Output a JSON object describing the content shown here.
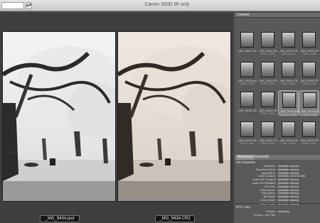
{
  "window_title": "Canon 350D IR only",
  "toolbar": {
    "stepper_icon": "▴▾"
  },
  "preview": {
    "captions": [
      "_MG_9434.psd",
      "_MG_9434.CR2"
    ]
  },
  "content_panel": {
    "tab_label": "Content",
    "items": [
      {
        "name": "_MG_9447.CR2",
        "info": "",
        "selected": false
      },
      {
        "name": "_MG_9441.CR2",
        "info": "2304 x 3456",
        "selected": false
      },
      {
        "name": "_MG_9437.CR2",
        "info": "2304 x 3456",
        "selected": false
      },
      {
        "name": "_MG_9440.CR2",
        "info": "2304 x 3456",
        "selected": false
      },
      {
        "name": "_MG_9442.psd",
        "info": "3456 x 2304",
        "selected": false
      },
      {
        "name": "_MG_9442.CR2",
        "info": "3456 x 2304",
        "selected": false
      },
      {
        "name": "_MG_9441.CR2",
        "info": "2304 x 3456",
        "selected": false
      },
      {
        "name": "_MG_9435.CR2",
        "info": "2304 x 3456",
        "selected": false
      },
      {
        "name": "_MG_9433.CR2",
        "info": "",
        "selected": false
      },
      {
        "name": "_MG_9432.CR2",
        "info": "2304 x 3456",
        "selected": false
      },
      {
        "name": "_MG_9434.psd",
        "info": "2304 x 3456",
        "selected": true
      },
      {
        "name": "_MG_9434.CR2",
        "info": "2304 x 3456",
        "selected": true
      },
      {
        "name": "_MG_9429.CR2",
        "info": "2304 x 3456",
        "selected": false
      },
      {
        "name": "_MG_9427.CR2",
        "info": "2304 x 3456",
        "selected": false
      },
      {
        "name": "_MG_9422.CR2",
        "info": "2304 x 3456",
        "selected": false
      },
      {
        "name": "_MG_9423.CR2",
        "info": "3456 x 2304",
        "selected": false
      }
    ]
  },
  "metadata_panel": {
    "tabs": [
      "Metadata",
      "Keywords"
    ],
    "file_properties_title": "File Properties",
    "fields": [
      {
        "key": "Filename",
        "value": "(Multiple values)"
      },
      {
        "key": "Document Kind",
        "value": "(Multiple values)"
      },
      {
        "key": "Application",
        "value": "(Multiple values)"
      },
      {
        "key": "Date Created",
        "value": "16/01/06, 2:52:19 AM"
      },
      {
        "key": "Date File Created",
        "value": "(Multiple values)"
      },
      {
        "key": "Date File Modified",
        "value": "(Multiple values)"
      },
      {
        "key": "File Size",
        "value": "(Multiple values)"
      },
      {
        "key": "Dimensions",
        "value": "(Multiple values)"
      },
      {
        "key": "Resolution",
        "value": "(Multiple values)"
      },
      {
        "key": "Bit Depth",
        "value": "(Multiple values)"
      },
      {
        "key": "Color Mode",
        "value": "(Multiple values)"
      },
      {
        "key": "Color Profile",
        "value": "(Multiple values)"
      }
    ],
    "iptc_title": "IPTC Core",
    "iptc_fields": [
      {
        "key": "Creator",
        "value": "unknown"
      },
      {
        "key": "Creator: Job Title",
        "value": ""
      }
    ]
  }
}
